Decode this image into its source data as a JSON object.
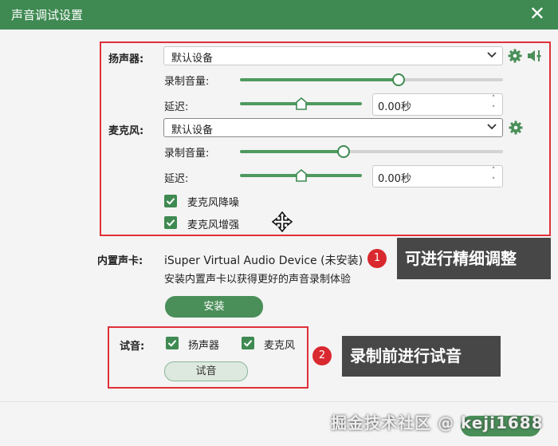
{
  "window": {
    "title": "声音调试设置",
    "close_symbol": "✕"
  },
  "speaker": {
    "label": "扬声器:",
    "device": "默认设备",
    "record_volume_label": "录制音量:",
    "record_volume_level": 0.6,
    "delay_label": "延迟:",
    "delay_level": 0.5,
    "delay_value": "0.00秒"
  },
  "mic": {
    "label": "麦克风:",
    "device": "默认设备",
    "record_volume_label": "录制音量:",
    "record_volume_level": 0.39,
    "delay_label": "延迟:",
    "delay_level": 0.5,
    "delay_value": "0.00秒",
    "noise_reduction": "麦克风降噪",
    "enhance": "麦克风增强"
  },
  "soundcard": {
    "label": "内置声卡:",
    "device_name": "iSuper Virtual Audio Device (未安装)",
    "hint": "安装内置声卡以获得更好的声音录制体验",
    "install_button": "安装"
  },
  "test": {
    "label": "试音:",
    "speaker_check": "扬声器",
    "mic_check": "麦克风",
    "button": "试音"
  },
  "annotations": {
    "badge1": "1",
    "tip1": "可进行精细调整",
    "badge2": "2",
    "tip2": "录制前进行试音"
  },
  "watermark": "掘金技术社区 @ keji1688",
  "colors": {
    "accent": "#3f8a52",
    "annotation_red": "#e0303a",
    "tooltip_bg": "#474747"
  },
  "icons": [
    "gear-icon",
    "speaker-sliders-icon",
    "chevron-down-icon",
    "spin-arrows-icon",
    "move-cursor-icon",
    "check-icon"
  ]
}
